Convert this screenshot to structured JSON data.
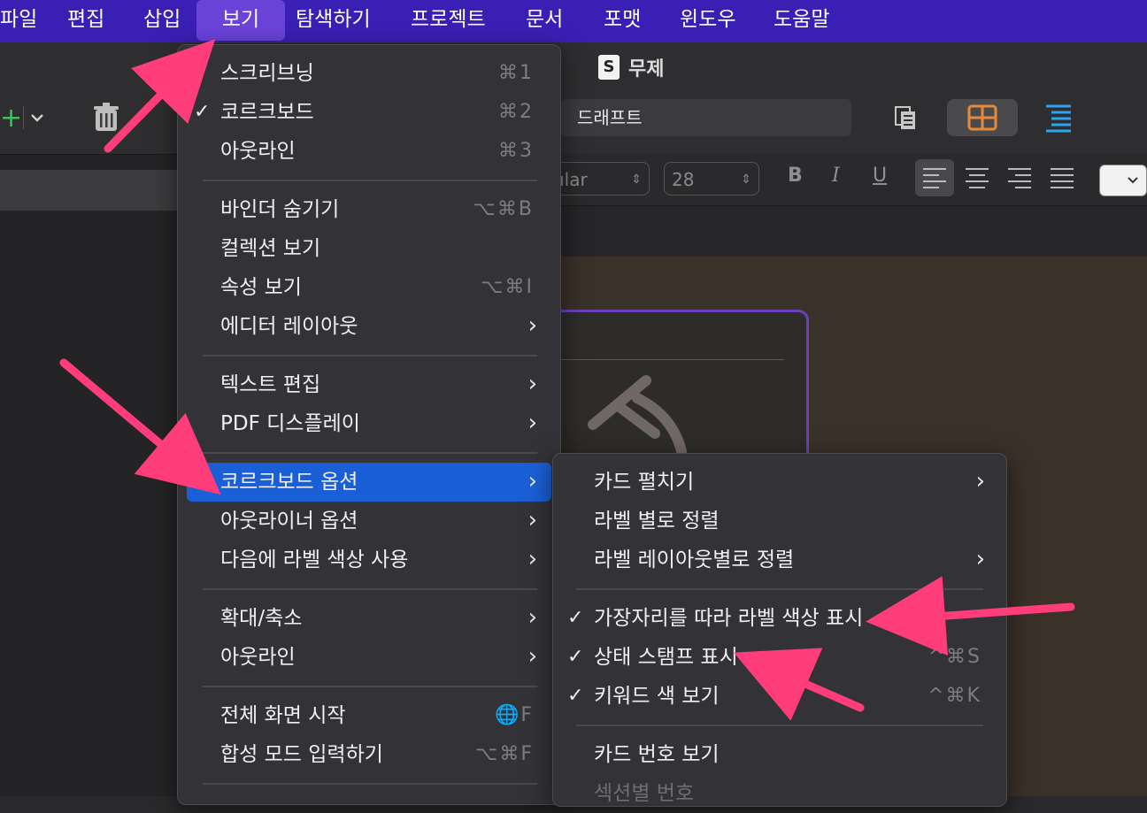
{
  "menubar": {
    "items": [
      "파일",
      "편집",
      "삽입",
      "보기",
      "탐색하기",
      "프로젝트",
      "문서",
      "포맷",
      "윈도우",
      "도움말"
    ],
    "active": "보기"
  },
  "window": {
    "title": "무제",
    "doc_icon": "S"
  },
  "toolbar": {
    "draft_label": "드래프트",
    "add_icon": "+",
    "chevron": "⌄",
    "icons": [
      "add-icon",
      "chevron-down-icon",
      "trash-icon",
      "copy-icon",
      "corkboard-icon",
      "outline-icon"
    ]
  },
  "format_bar": {
    "font_style": "ular",
    "font_size": "28",
    "bold": "B",
    "italic": "I",
    "underline": "U"
  },
  "view_menu": {
    "items": [
      {
        "label": "스크리브닝",
        "shortcut": "⌘1",
        "checked": false
      },
      {
        "label": "코르크보드",
        "shortcut": "⌘2",
        "checked": true
      },
      {
        "label": "아웃라인",
        "shortcut": "⌘3",
        "checked": false
      },
      {
        "label": "바인더 숨기기",
        "shortcut": "⌥⌘B"
      },
      {
        "label": "컬렉션 보기",
        "shortcut": ""
      },
      {
        "label": "속성 보기",
        "shortcut": "⌥⌘I"
      },
      {
        "label": "에디터 레이아웃",
        "submenu": true
      },
      {
        "label": "텍스트 편집",
        "submenu": true
      },
      {
        "label": "PDF 디스플레이",
        "submenu": true
      },
      {
        "label": "코르크보드 옵션",
        "submenu": true,
        "highlighted": true
      },
      {
        "label": "아웃라이너 옵션",
        "submenu": true
      },
      {
        "label": "다음에 라벨 색상 사용",
        "submenu": true
      },
      {
        "label": "확대/축소",
        "submenu": true
      },
      {
        "label": "아웃라인",
        "submenu": true
      },
      {
        "label": "전체 화면 시작",
        "shortcut": "🌐F"
      },
      {
        "label": "합성 모드 입력하기",
        "shortcut": "⌥⌘F"
      }
    ],
    "check_glyph": "✓",
    "submenu_glyph": "›"
  },
  "corkboard_submenu": {
    "items": [
      {
        "label": "카드 펼치기",
        "submenu": true
      },
      {
        "label": "라벨 별로 정렬"
      },
      {
        "label": "라벨 레이아웃별로 정렬",
        "submenu": true
      },
      {
        "label": "가장자리를 따라 라벨 색상 표시",
        "checked": true,
        "shortcut": ""
      },
      {
        "label": "상태 스탬프 표시",
        "checked": true,
        "shortcut": "^⌘S"
      },
      {
        "label": "키워드 색 보기",
        "checked": true,
        "shortcut": "^⌘K"
      },
      {
        "label": "카드 번호 보기"
      },
      {
        "label": "섹션별 번호",
        "disabled": true
      }
    ]
  },
  "colors": {
    "menubar": "#3a1fb5",
    "highlight": "#1b5fd6",
    "arrow": "#ff3d7a",
    "card_border": "#6c3fb8"
  }
}
